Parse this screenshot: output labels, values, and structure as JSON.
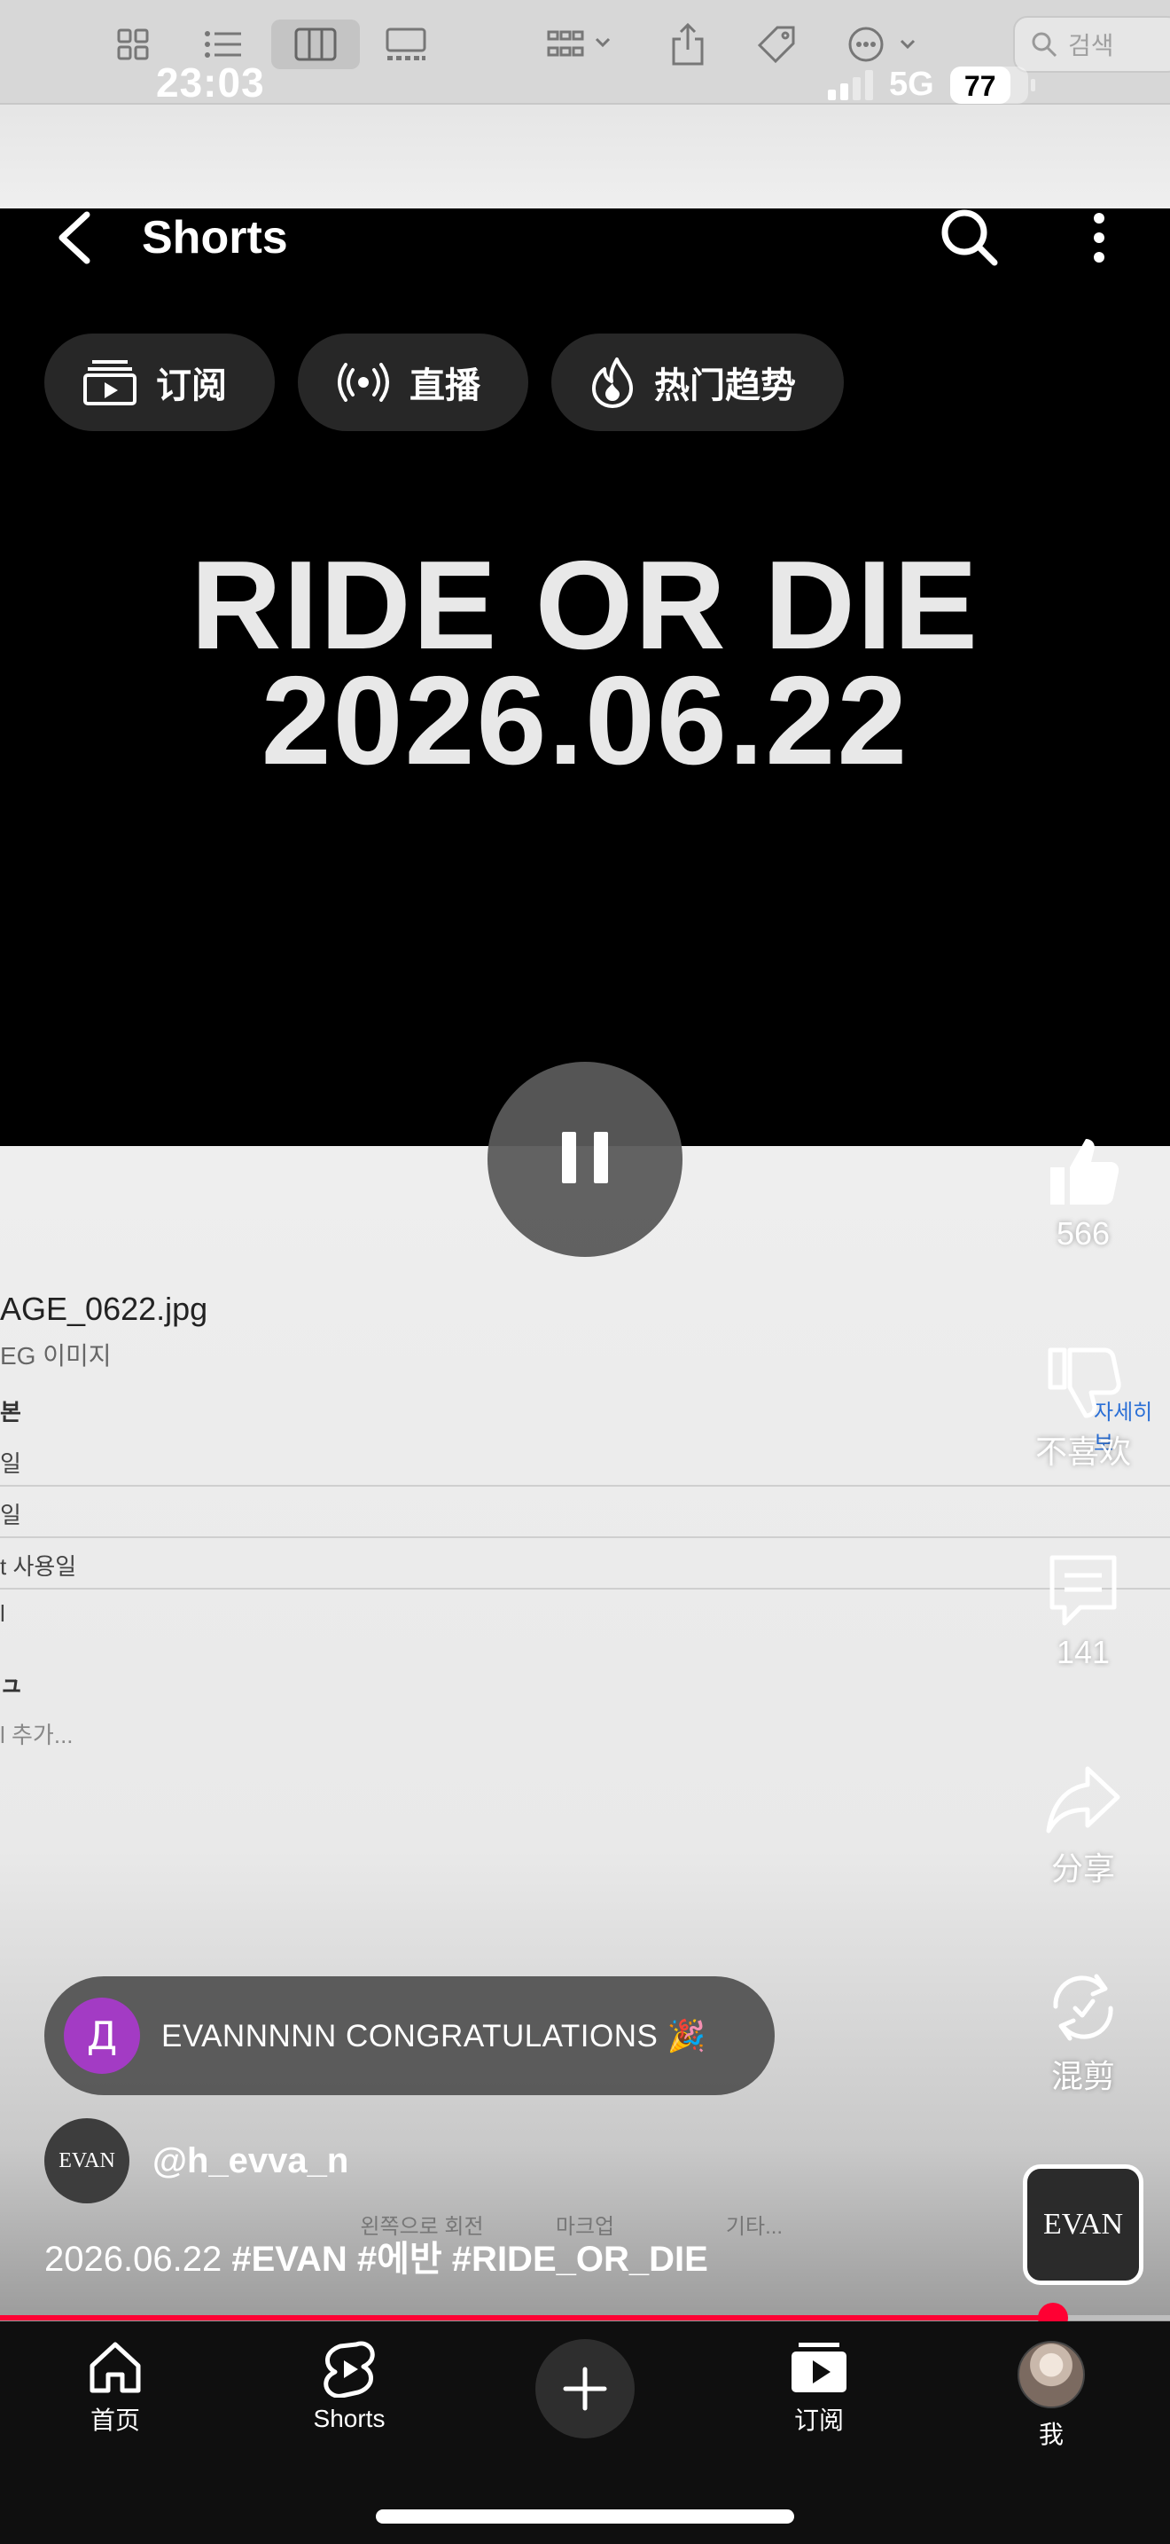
{
  "status_bar": {
    "time": "23:03",
    "network": "5G",
    "battery": "77"
  },
  "background_finder": {
    "search_placeholder": "검색",
    "file_name": "AGE_0622.jpg",
    "file_kind": "EG 이미지",
    "rows": [
      "본",
      "일",
      "일",
      "t 사용일",
      "l",
      "ュ",
      "l 추가..."
    ],
    "more_link": "자세히 보",
    "bottom_tools": [
      "왼쪽으로 회전",
      "마크업",
      "기타..."
    ]
  },
  "header": {
    "title": "Shorts"
  },
  "chips": [
    {
      "label": "订阅",
      "icon": "subscriptions-icon"
    },
    {
      "label": "直播",
      "icon": "live-icon"
    },
    {
      "label": "热门趋势",
      "icon": "trending-flame-icon"
    }
  ],
  "video": {
    "title_line1": "RIDE OR DIE",
    "title_line2": "2026.06.22",
    "progress": 0.9
  },
  "actions": {
    "like_count": "566",
    "dislike_label": "不喜欢",
    "comment_count": "141",
    "share_label": "分享",
    "remix_label": "混剪",
    "sound_label": "EVAN"
  },
  "top_comment": {
    "avatar_letter": "Д",
    "text": "EVANNNNN CONGRATULATIONS 🎉"
  },
  "channel": {
    "avatar_text": "EVAN",
    "handle": "@h_evva_n"
  },
  "caption": {
    "date": "2026.06.22",
    "tags": "#EVAN #에반 #RIDE_OR_DIE"
  },
  "nav": {
    "home": "首页",
    "shorts": "Shorts",
    "subscriptions": "订阅",
    "me": "我"
  },
  "colors": {
    "accent": "#ff0033",
    "chip_bg": "#272727",
    "comment_avatar": "#a33bc4"
  }
}
